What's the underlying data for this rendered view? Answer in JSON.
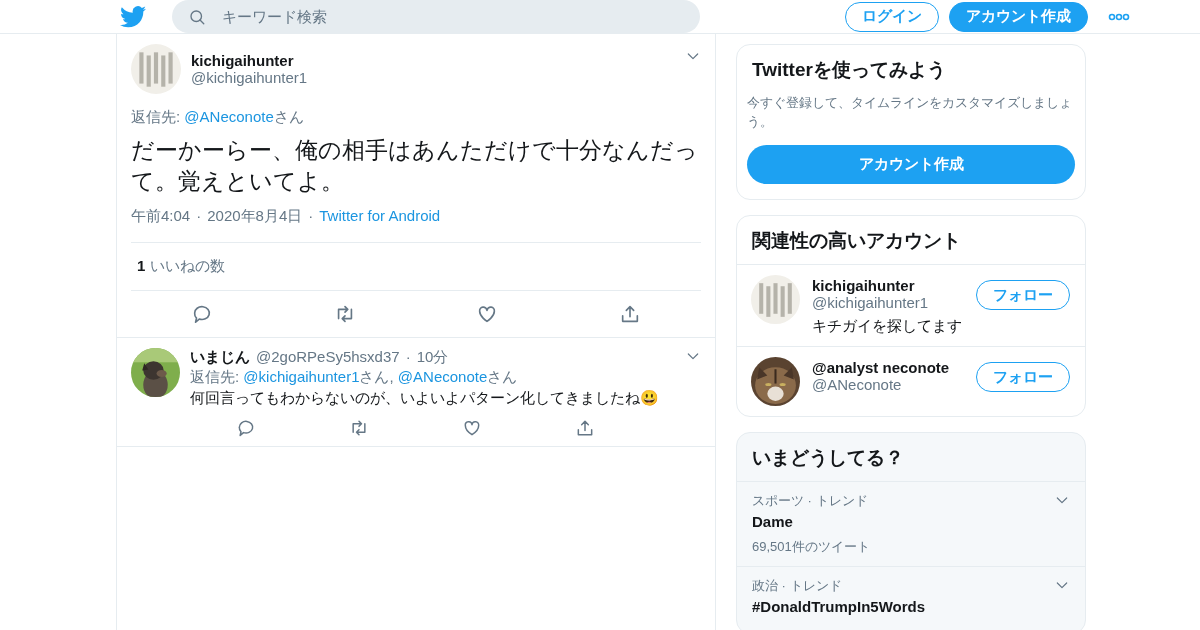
{
  "header": {
    "search": {
      "placeholder": "キーワード検索"
    },
    "login": "ログイン",
    "signup": "アカウント作成"
  },
  "tweet": {
    "name": "kichigaihunter",
    "handle": "@kichigaihunter1",
    "reply_prefix": "返信先:",
    "mentions": [
      {
        "handle": "@ANeconote",
        "suffix": "さん"
      }
    ],
    "text": "だーかーらー、俺の相手はあんただけで十分なんだって。覚えといてよ。",
    "time": "午前4:04",
    "date_separator": "·",
    "date": "2020年8月4日",
    "source_separator": "·",
    "source": "Twitter for Android",
    "likes_count": "1",
    "likes_label": "いいねの数"
  },
  "reply": {
    "name": "いまじん",
    "handle": "@2goRPeSy5hsxd37",
    "time_separator": "·",
    "time": "10分",
    "reply_prefix": "返信先:",
    "mentions": [
      {
        "handle": "@kichigaihunter1",
        "suffix": "さん"
      },
      {
        "handle": "@ANeconote",
        "suffix": "さん"
      }
    ],
    "separator": ",",
    "text": "何回言ってもわからないのが、いよいよパターン化してきましたね😃"
  },
  "signup_card": {
    "title": "Twitterを使ってみよう",
    "text": "今すぐ登録して、タイムラインをカスタマイズしましょう。",
    "button": "アカウント作成"
  },
  "related": {
    "title": "関連性の高いアカウント",
    "accounts": [
      {
        "name": "kichigaihunter",
        "handle": "@kichigaihunter1",
        "bio": "キチガイを探してます",
        "follow": "フォロー"
      },
      {
        "name": "@analyst neconote",
        "handle": "@ANeconote",
        "follow": "フォロー"
      }
    ]
  },
  "trends": {
    "title": "いまどうしてる？",
    "items": [
      {
        "context": "スポーツ · トレンド",
        "name": "Dame",
        "count": "69,501件のツイート"
      },
      {
        "context": "政治 · トレンド",
        "name": "#DonaldTrumpIn5Words"
      }
    ]
  }
}
